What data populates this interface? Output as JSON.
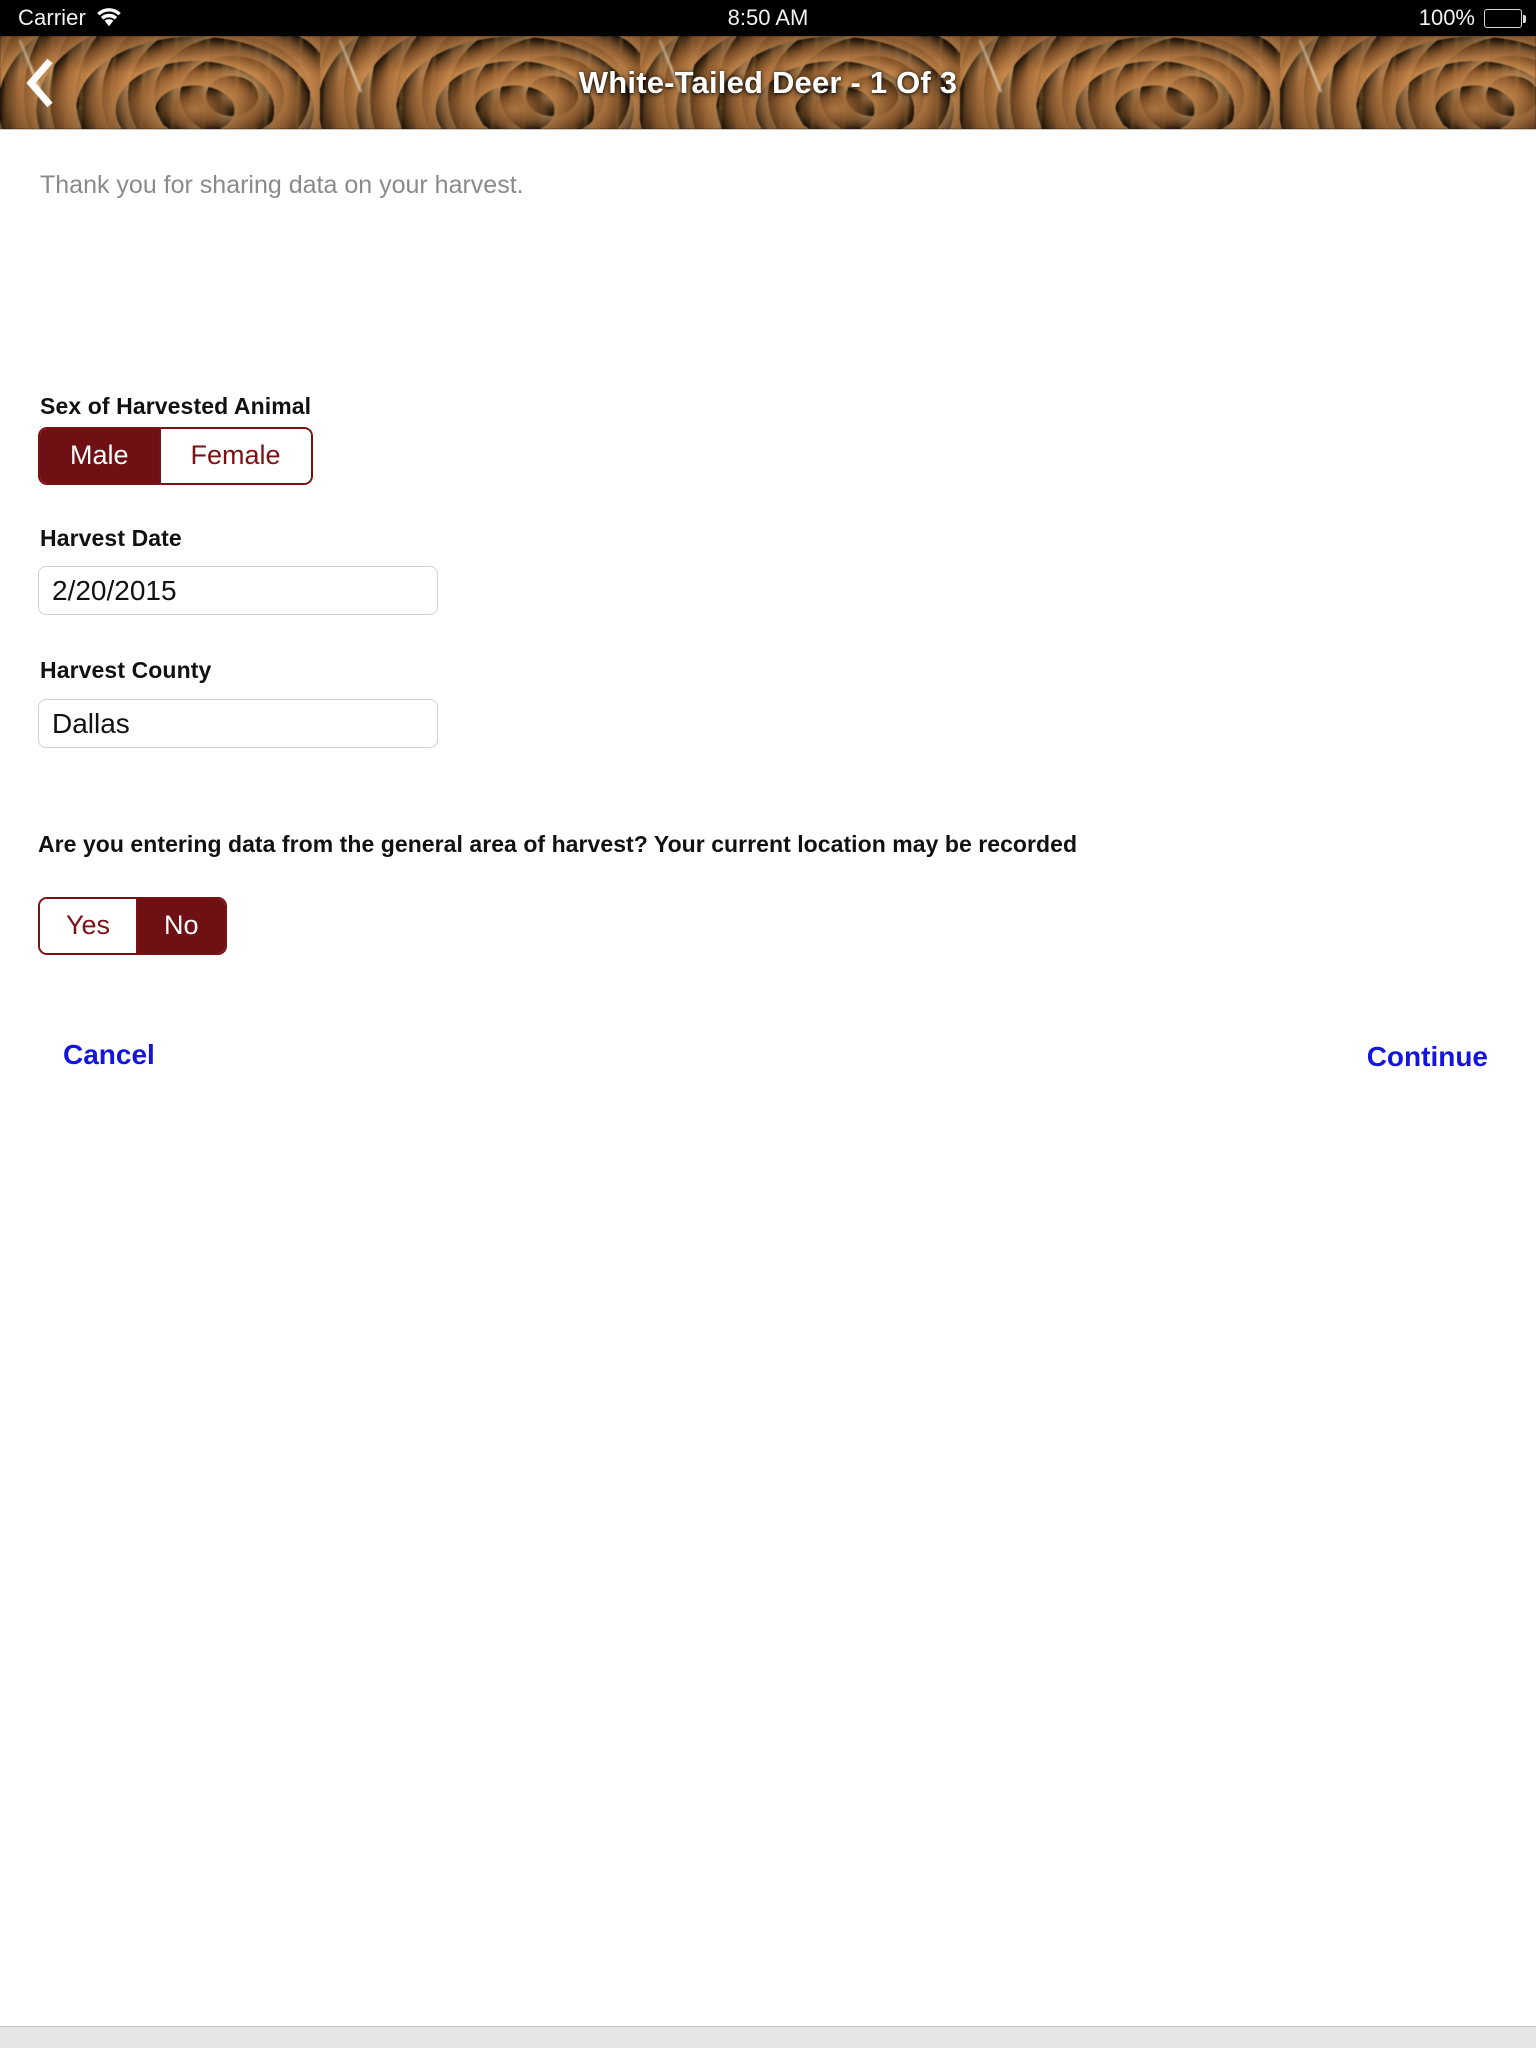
{
  "status_bar": {
    "carrier": "Carrier",
    "wifi_icon": "wifi-icon",
    "time": "8:50 AM",
    "battery_percent": "100%",
    "battery_icon": "battery-full-icon"
  },
  "header": {
    "back_icon": "chevron-left-icon",
    "title": "White-Tailed Deer - 1 Of 3"
  },
  "form": {
    "intro": "Thank you for sharing data on your harvest.",
    "sex": {
      "label": "Sex of Harvested Animal",
      "options": [
        "Male",
        "Female"
      ],
      "selected": "Male"
    },
    "harvest_date": {
      "label": "Harvest Date",
      "value": "2/20/2015",
      "placeholder": "Harvest Date"
    },
    "harvest_county": {
      "label": "Harvest County",
      "value": "Dallas",
      "placeholder": "Harvest County"
    },
    "location_question": {
      "label": "Are you entering data from the general area of harvest? Your current location may be recorded",
      "options": [
        "Yes",
        "No"
      ],
      "selected": "No"
    }
  },
  "actions": {
    "cancel": "Cancel",
    "continue": "Continue"
  },
  "colors": {
    "accent_maroon": "#6e1014",
    "accent_border": "#7a1115",
    "link_blue": "#1414e0",
    "muted_text": "#8a8a8a"
  }
}
